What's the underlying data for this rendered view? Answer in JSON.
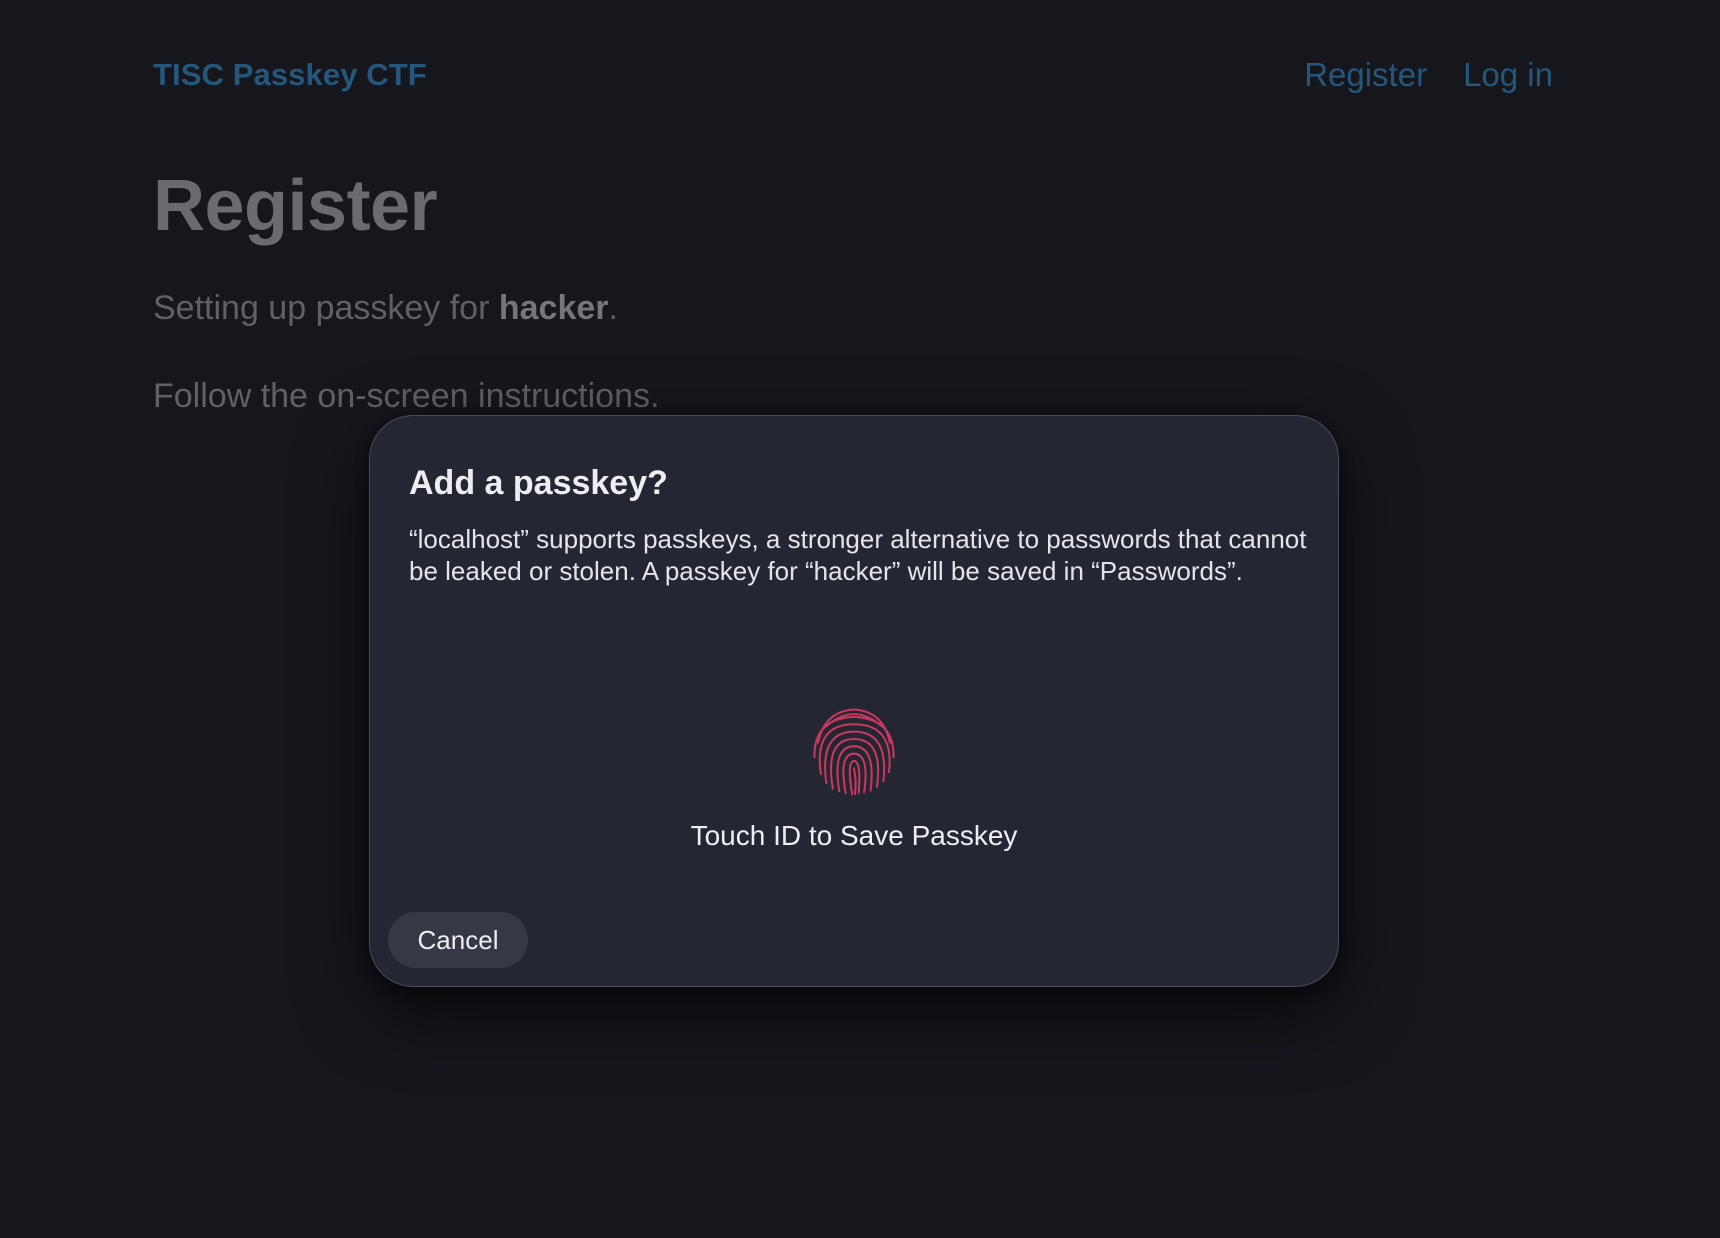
{
  "site": {
    "brand": "TISC Passkey CTF",
    "nav": [
      {
        "label": "Register"
      },
      {
        "label": "Log in"
      }
    ]
  },
  "page": {
    "title": "Register",
    "lead_prefix": "Setting up passkey for ",
    "username": "hacker",
    "lead_suffix": ".",
    "instructions": "Follow the on-screen instructions."
  },
  "dialog": {
    "title": "Add a passkey?",
    "body": "“localhost” supports passkeys, a stronger alternative to passwords that cannot be leaked or stolen. A passkey for “hacker” will be saved in “Passwords”.",
    "icon": "fingerprint-icon",
    "touch_label": "Touch ID to Save Passkey",
    "cancel_label": "Cancel"
  },
  "colors": {
    "background": "#15171c",
    "link": "#25577c",
    "dialog_bg": "#242632",
    "fingerprint": "#c9395f",
    "button_bg": "#363945"
  }
}
